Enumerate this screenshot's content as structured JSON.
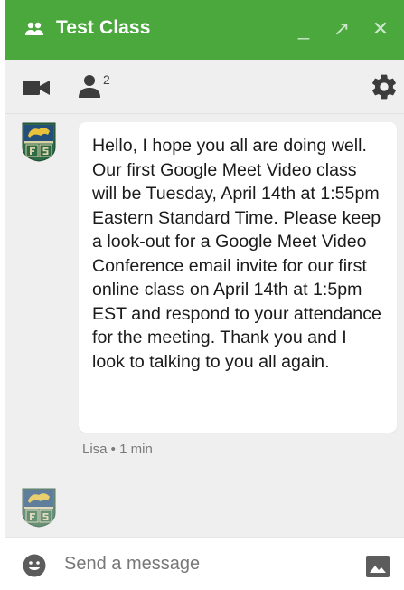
{
  "header": {
    "title": "Test Class",
    "minimize_label": "_",
    "popout_label": "↗",
    "close_label": "✕",
    "icon": "group-chat-icon",
    "color": "#4aa83d"
  },
  "toolbar": {
    "video_icon": "video-camera-icon",
    "people_icon": "person-icon",
    "participant_count": "2",
    "settings_icon": "gear-icon"
  },
  "messages": [
    {
      "avatar": "school-crest-avatar",
      "text": "Hello, I hope you all are doing well. Our first Google Meet Video class will be Tuesday, April 14th at 1:55pm Eastern Standard Time. Please keep a look-out for a Google Meet Video Conference email invite for our first online class on April 14th at 1:5pm EST and respond to your attendance for the meeting. Thank you and I look to talking to you all again.",
      "meta": "Lisa • 1 min"
    }
  ],
  "composer": {
    "placeholder": "Send a message",
    "emoji_icon": "emoji-icon",
    "image_icon": "image-icon"
  }
}
